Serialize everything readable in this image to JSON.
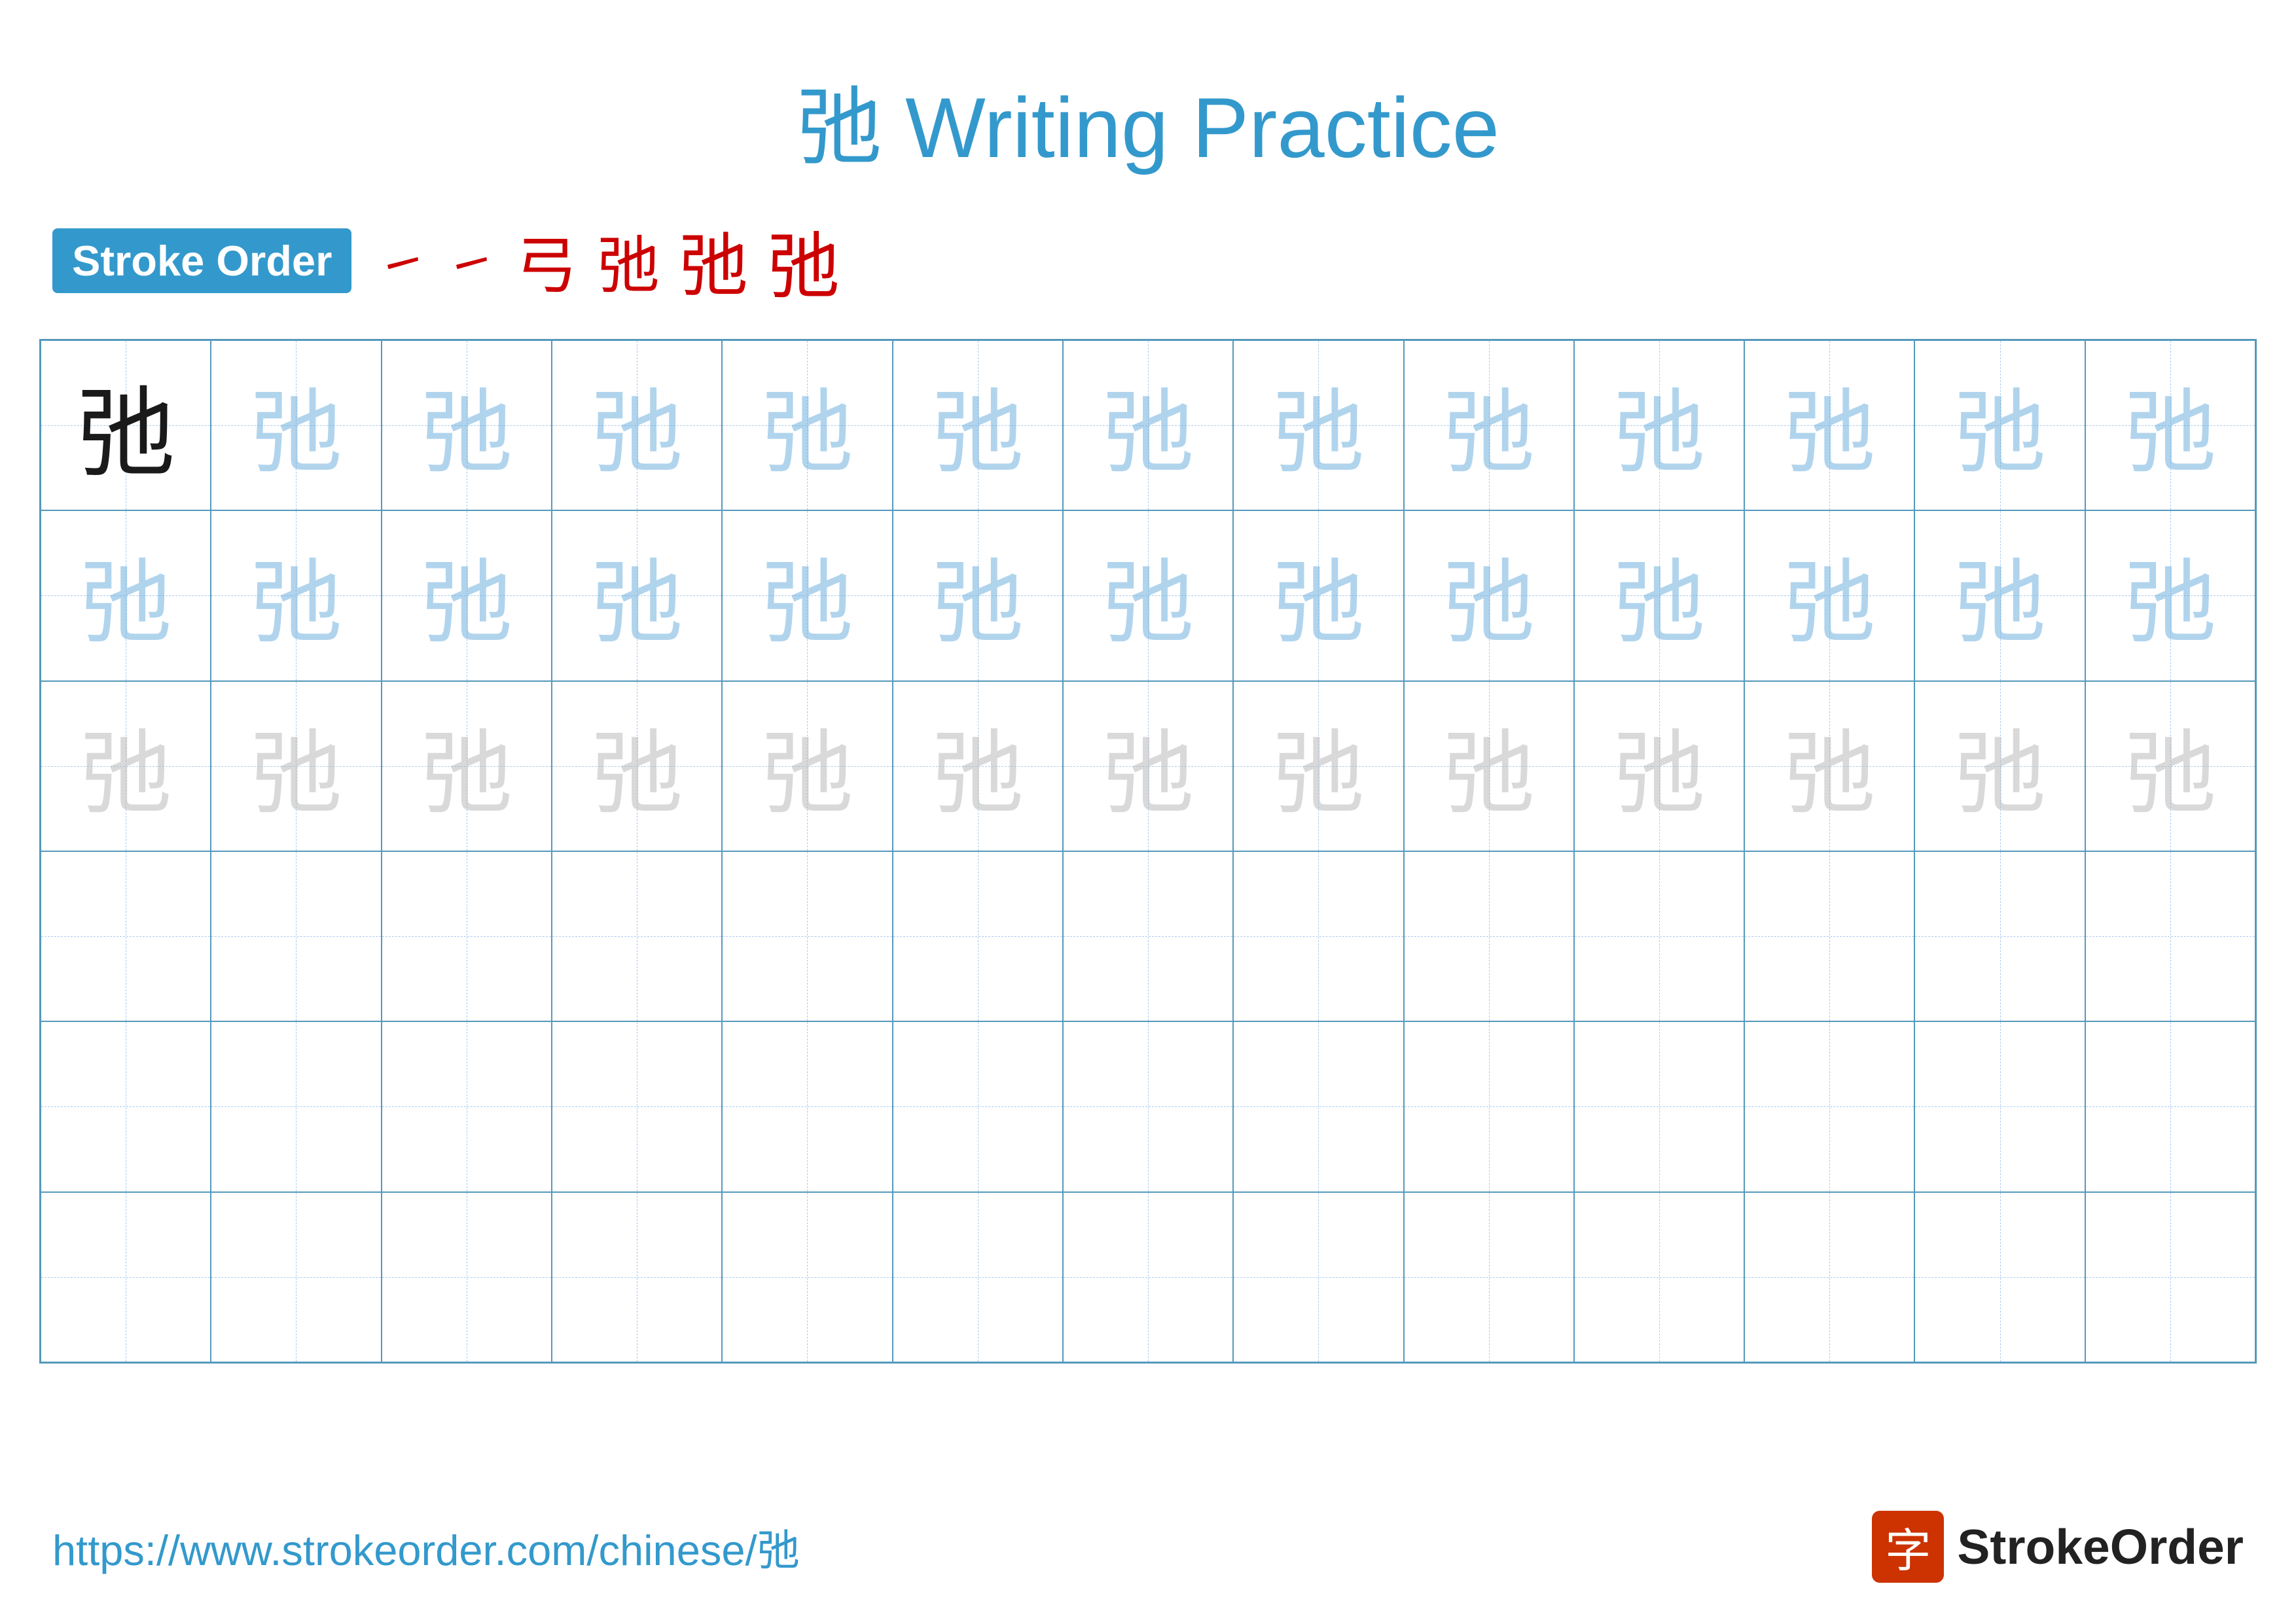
{
  "title": "弛 Writing Practice",
  "stroke_order": {
    "badge_label": "Stroke Order",
    "steps": [
      "㇀",
      "㇀",
      "弓",
      "弛",
      "弛",
      "弛"
    ]
  },
  "character": "弛",
  "grid": {
    "rows": 6,
    "cols": 13
  },
  "footer": {
    "url": "https://www.strokeorder.com/chinese/弛",
    "brand_name": "StrokeOrder",
    "brand_icon": "字"
  }
}
